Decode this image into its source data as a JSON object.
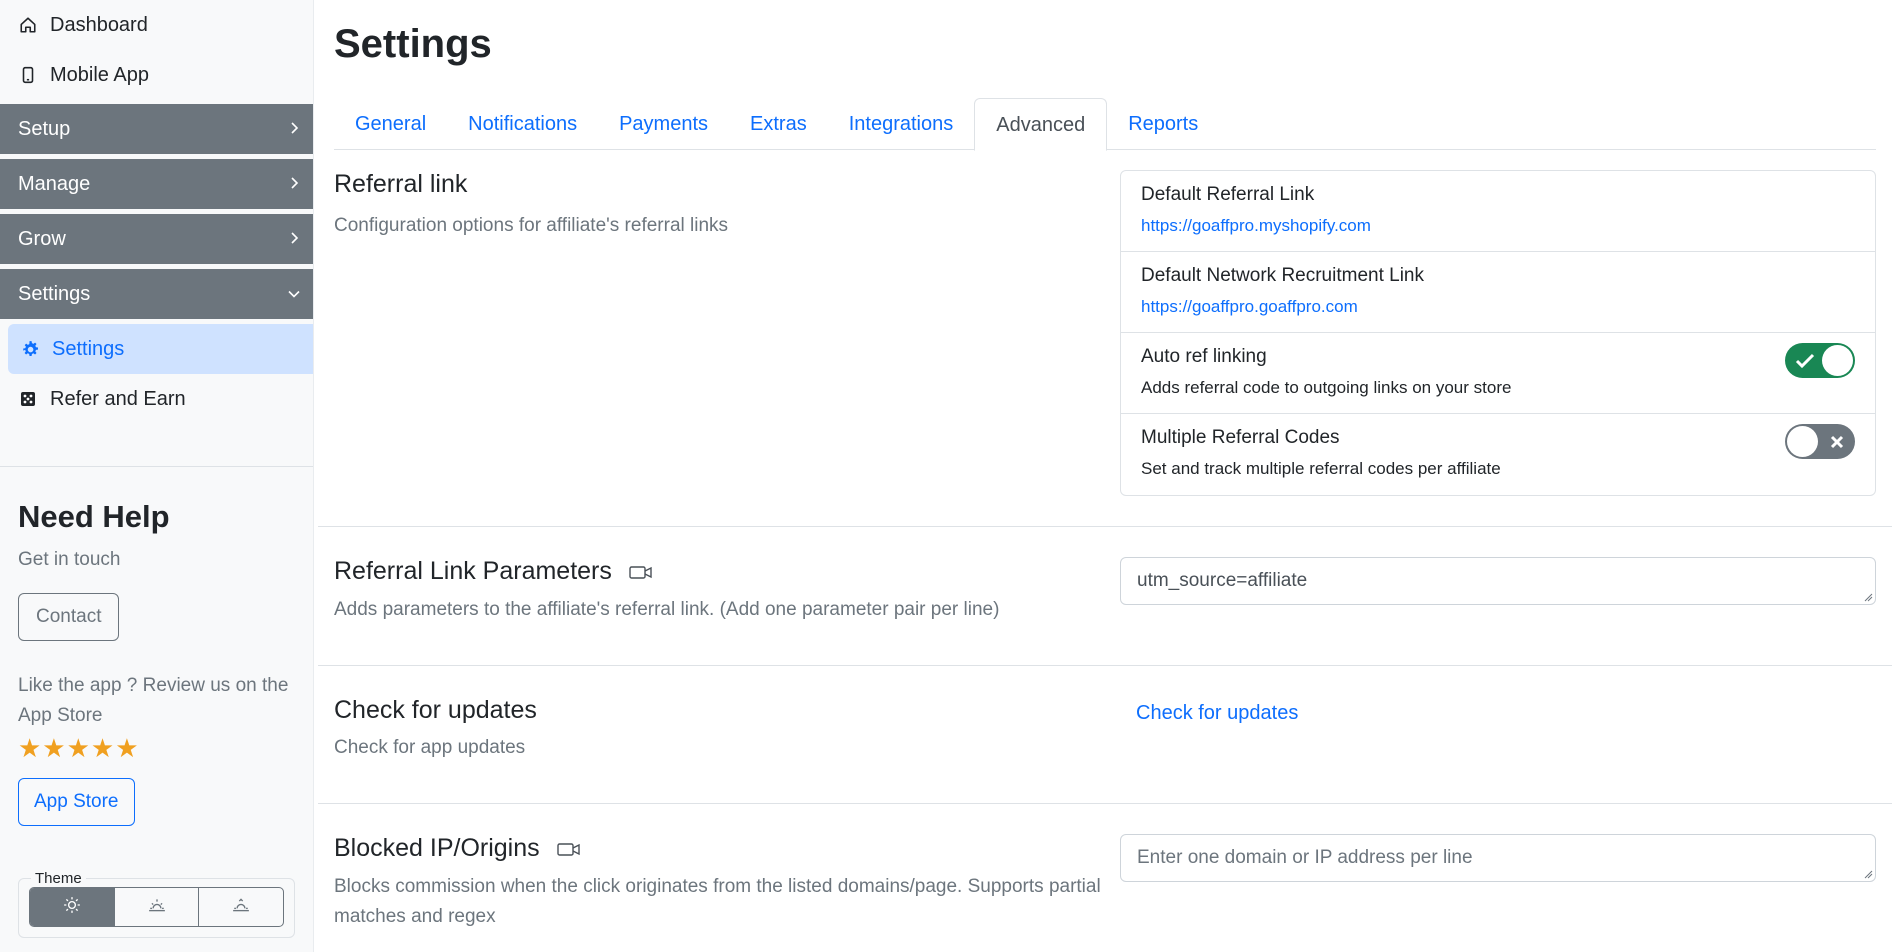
{
  "sidebar": {
    "top_links": [
      {
        "label": "Dashboard",
        "icon": "home-icon"
      },
      {
        "label": "Mobile App",
        "icon": "mobile-icon"
      }
    ],
    "groups": [
      {
        "label": "Setup",
        "state": "collapsed"
      },
      {
        "label": "Manage",
        "state": "collapsed"
      },
      {
        "label": "Grow",
        "state": "collapsed"
      },
      {
        "label": "Settings",
        "state": "expanded"
      }
    ],
    "settings_children": [
      {
        "label": "Settings",
        "icon": "gear-icon",
        "active": true
      },
      {
        "label": "Refer and Earn",
        "icon": "dice-icon",
        "active": false
      }
    ],
    "help": {
      "title": "Need Help",
      "subtitle": "Get in touch",
      "contact_label": "Contact",
      "review_text": "Like the app ? Review us on the App Store",
      "stars": "★★★★★",
      "app_store_label": "App Store"
    },
    "theme": {
      "legend": "Theme",
      "options": [
        "sun-icon",
        "sunrise-icon",
        "sunset-icon"
      ],
      "selected": 0
    }
  },
  "main": {
    "title": "Settings",
    "tabs": [
      {
        "label": "General"
      },
      {
        "label": "Notifications"
      },
      {
        "label": "Payments"
      },
      {
        "label": "Extras"
      },
      {
        "label": "Integrations"
      },
      {
        "label": "Advanced",
        "active": true
      },
      {
        "label": "Reports"
      }
    ],
    "referral": {
      "title": "Referral link",
      "desc": "Configuration options for affiliate's referral links",
      "items": [
        {
          "title": "Default Referral Link",
          "link": "https://goaffpro.myshopify.com"
        },
        {
          "title": "Default Network Recruitment Link",
          "link": "https://goaffpro.goaffpro.com"
        },
        {
          "title": "Auto ref linking",
          "sub": "Adds referral code to outgoing links on your store",
          "toggle": true
        },
        {
          "title": "Multiple Referral Codes",
          "sub": "Set and track multiple referral codes per affiliate",
          "toggle": false
        }
      ]
    },
    "params": {
      "title": "Referral Link Parameters",
      "desc": "Adds parameters to the affiliate's referral link. (Add one parameter pair per line)",
      "value": "utm_source=affiliate"
    },
    "updates": {
      "title": "Check for updates",
      "desc": "Check for app updates",
      "link": "Check for updates"
    },
    "blocked": {
      "title": "Blocked IP/Origins",
      "desc": "Blocks commission when the click originates from the listed domains/page. Supports partial matches and regex",
      "placeholder": "Enter one domain or IP address per line"
    }
  },
  "colors": {
    "accent": "#0d6efd",
    "nav_group_bg": "#6c757d",
    "active_nav_bg": "#cfe2ff",
    "toggle_on": "#198754",
    "star": "#f0a020"
  }
}
